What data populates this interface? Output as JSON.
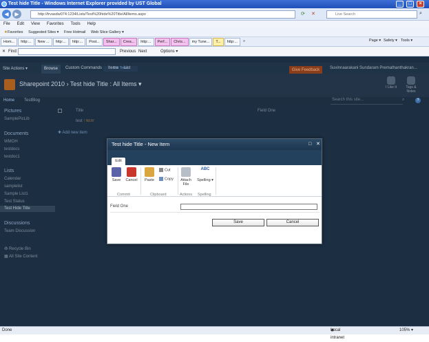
{
  "window": {
    "title": "Test hide Title - Windows Internet Explorer provided by UST Global"
  },
  "address": {
    "url": "http://trvasdw074:1234/Lists/Test%20hide%20Title/AllItems.aspx",
    "search_placeholder": "Live Search"
  },
  "menu": [
    "File",
    "Edit",
    "View",
    "Favorites",
    "Tools",
    "Help"
  ],
  "favorites": {
    "label": "Favorites",
    "items": [
      "Suggested Sites ▾",
      "Free Hotmail",
      "Web Slice Gallery ▾"
    ]
  },
  "tabs": [
    "Hom...",
    "http:...",
    "New ...",
    "http:...",
    "http:...",
    "Post...",
    "Shar...",
    "Crea...",
    "http:...",
    "Perf...",
    "Chris...",
    "my Tune...",
    "T...",
    "http:...",
    "»"
  ],
  "tools": [
    "Page ▾",
    "Safety ▾",
    "Tools ▾"
  ],
  "find": {
    "label": "Find:",
    "previous": "Previous",
    "next": "Next",
    "options": "Options ▾"
  },
  "sharepoint": {
    "site_actions": "Site Actions ▾",
    "browse": "Browse",
    "custom_commands": "Custom Commands",
    "items": "Items",
    "list": "List",
    "list_tools": "List Tools",
    "feedback": "Give Feedback",
    "user": "Suvinnaarakani Sundaram Premathanthakran...",
    "breadcrumb": {
      "site": "Sharepoint 2010",
      "sep": "›",
      "list": "Test hide Title",
      "view": ": All Items ▾"
    },
    "like": "I Like It",
    "tags": "Tags & Notes",
    "nav": {
      "home": "Home",
      "testblog": "TestBlog",
      "search": "Search this site..."
    },
    "leftnav": {
      "pictures": "Pictures",
      "samplepic": "SamplePicLib",
      "documents": "Documents",
      "wmoh": "WMOH",
      "testdoc": "testdocs",
      "testdoc1": "testdoc1",
      "lists": "Lists",
      "calendar": "Calendar",
      "samplelist": "samplelist",
      "samplelist1": "Sample List1",
      "teststatus": "Test Status",
      "testhidetitle": "Test Hide Title",
      "discussions": "Discussions",
      "teamdisc": "Team Discussion",
      "recycle": "Recycle Bin",
      "allcontent": "All Site Content"
    },
    "list_header": {
      "title": "Title",
      "field": "Field One"
    },
    "list_row": {
      "title": "test",
      "new": "! NEW"
    },
    "add_new": "Add new item"
  },
  "dialog": {
    "title": "Test hide Title - New Item",
    "tab": "Edit",
    "save": "Save",
    "cancel": "Cancel",
    "paste": "Paste",
    "cut": "Cut",
    "copy": "Copy",
    "attach": "Attach File",
    "spelling": "Spelling ▾",
    "groups": {
      "commit": "Commit",
      "clipboard": "Clipboard",
      "actions": "Actions",
      "spelling": "Spelling"
    },
    "field_label": "Field One",
    "btn_save": "Save",
    "btn_cancel": "Cancel"
  },
  "status": {
    "left": "Done",
    "zone": "Local intranet",
    "zoom": "105% ▾"
  }
}
